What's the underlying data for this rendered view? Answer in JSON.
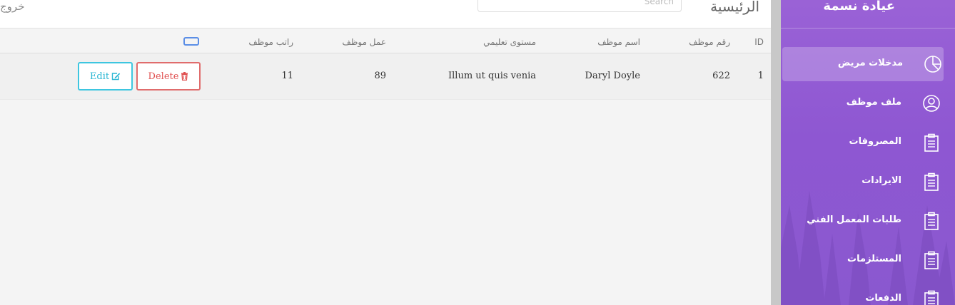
{
  "header": {
    "logout_label": "خروج",
    "page_title": "الرئيسية",
    "search_placeholder": "Search"
  },
  "table": {
    "columns": {
      "id": "ID",
      "emp_number": "رقم موظف",
      "emp_name": "اسم موظف",
      "education": "مستوى تعليمي",
      "job": "عمل موظف",
      "salary": "راتب موظف"
    },
    "rows": [
      {
        "id": "1",
        "emp_number": "622",
        "emp_name": "Daryl Doyle",
        "education": "Illum ut quis venia",
        "job": "89",
        "salary": "11",
        "delete_label": "Delete",
        "edit_label": "Edit"
      }
    ]
  },
  "sidebar": {
    "brand": "عيادة نسمة",
    "items": [
      {
        "label": "مدخلات مريض",
        "icon": "pie-chart-icon",
        "active": true
      },
      {
        "label": "ملف موظف",
        "icon": "user-circle-icon",
        "active": false
      },
      {
        "label": "المصروفات",
        "icon": "clipboard-icon",
        "active": false
      },
      {
        "label": "الايرادات",
        "icon": "clipboard-icon",
        "active": false
      },
      {
        "label": "طلبات المعمل الفني",
        "icon": "clipboard-icon",
        "active": false
      },
      {
        "label": "المستلزمات",
        "icon": "clipboard-icon",
        "active": false
      },
      {
        "label": "الدفعات",
        "icon": "clipboard-icon",
        "active": false
      }
    ]
  },
  "colors": {
    "sidebar_accent": "#9a62d6",
    "delete": "#e05050",
    "edit": "#2bb7d4"
  }
}
